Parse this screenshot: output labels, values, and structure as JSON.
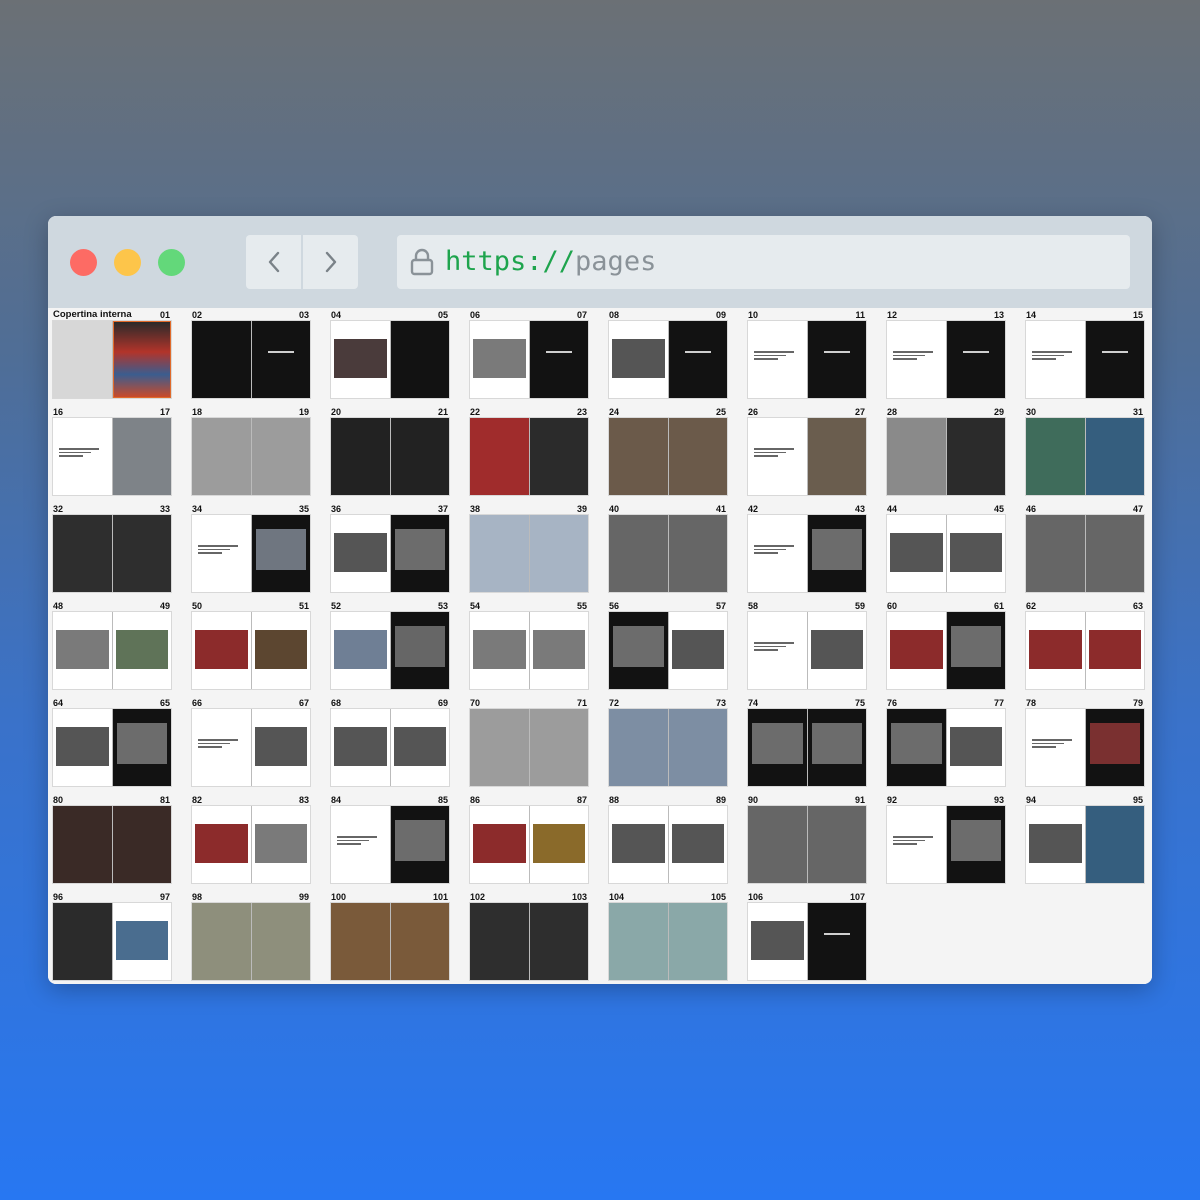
{
  "browser": {
    "url_scheme": "https://",
    "url_path": "pages",
    "back_icon": "chevron-left-icon",
    "forward_icon": "chevron-right-icon",
    "lock_icon": "lock-icon",
    "colors": {
      "close": "#fd6b64",
      "minimize": "#fdc54a",
      "maximize": "#63d87a",
      "scheme": "#1ea44d"
    }
  },
  "spreads": [
    {
      "left": "Copertina interna",
      "right": "01",
      "pages": [
        "gray",
        "cover"
      ]
    },
    {
      "left": "02",
      "right": "03",
      "pages": [
        "black",
        "black-title"
      ]
    },
    {
      "left": "04",
      "right": "05",
      "pages": [
        "white-photo-rose",
        "black"
      ]
    },
    {
      "left": "06",
      "right": "07",
      "pages": [
        "white-photo-gray",
        "black-text"
      ]
    },
    {
      "left": "08",
      "right": "09",
      "pages": [
        "white-photo-bw",
        "black-title"
      ]
    },
    {
      "left": "10",
      "right": "11",
      "pages": [
        "white-text",
        "black-title"
      ]
    },
    {
      "left": "12",
      "right": "13",
      "pages": [
        "white-text",
        "black-title"
      ]
    },
    {
      "left": "14",
      "right": "15",
      "pages": [
        "white-text",
        "black-title"
      ]
    },
    {
      "left": "16",
      "right": "17",
      "pages": [
        "white-text",
        "photo-fog"
      ]
    },
    {
      "left": "18",
      "right": "19",
      "pages": [
        "full-gray",
        "full-gray"
      ]
    },
    {
      "left": "20",
      "right": "21",
      "pages": [
        "black-sky",
        "black-sky"
      ]
    },
    {
      "left": "22",
      "right": "23",
      "pages": [
        "photo-red",
        "photo-dark"
      ]
    },
    {
      "left": "24",
      "right": "25",
      "pages": [
        "full-brown",
        "full-brown"
      ]
    },
    {
      "left": "26",
      "right": "27",
      "pages": [
        "white-text",
        "photo-street"
      ]
    },
    {
      "left": "28",
      "right": "29",
      "pages": [
        "photo-gray",
        "photo-dark"
      ]
    },
    {
      "left": "30",
      "right": "31",
      "pages": [
        "photo-green",
        "photo-blue"
      ]
    },
    {
      "left": "32",
      "right": "33",
      "pages": [
        "full-dark",
        "full-dark"
      ]
    },
    {
      "left": "34",
      "right": "35",
      "pages": [
        "white-text",
        "black-fog"
      ]
    },
    {
      "left": "36",
      "right": "37",
      "pages": [
        "white-photo-bw",
        "black-photo"
      ]
    },
    {
      "left": "38",
      "right": "39",
      "pages": [
        "full-umbrella",
        "full-umbrella"
      ]
    },
    {
      "left": "40",
      "right": "41",
      "pages": [
        "full-bw",
        "full-bw"
      ]
    },
    {
      "left": "42",
      "right": "43",
      "pages": [
        "white-text",
        "black-photo"
      ]
    },
    {
      "left": "44",
      "right": "45",
      "pages": [
        "white-photo-bw",
        "white-photo-bw"
      ]
    },
    {
      "left": "46",
      "right": "47",
      "pages": [
        "full-bw",
        "full-bw"
      ]
    },
    {
      "left": "48",
      "right": "49",
      "pages": [
        "white-photo-gray",
        "white-photo-green"
      ]
    },
    {
      "left": "50",
      "right": "51",
      "pages": [
        "white-photo-red",
        "white-photo-brown"
      ]
    },
    {
      "left": "52",
      "right": "53",
      "pages": [
        "white-photo-blur",
        "black-sign"
      ]
    },
    {
      "left": "54",
      "right": "55",
      "pages": [
        "white-photo-gray",
        "white-photo-gray"
      ]
    },
    {
      "left": "56",
      "right": "57",
      "pages": [
        "black-photo",
        "white-photo-bw"
      ]
    },
    {
      "left": "58",
      "right": "59",
      "pages": [
        "white-text",
        "white-photo-bw"
      ]
    },
    {
      "left": "60",
      "right": "61",
      "pages": [
        "white-photo-red",
        "black-photo"
      ]
    },
    {
      "left": "62",
      "right": "63",
      "pages": [
        "white-photo-red",
        "white-photo-red"
      ]
    },
    {
      "left": "64",
      "right": "65",
      "pages": [
        "white-photo-bw",
        "black-photo"
      ]
    },
    {
      "left": "66",
      "right": "67",
      "pages": [
        "white-text",
        "white-photo-bw"
      ]
    },
    {
      "left": "68",
      "right": "69",
      "pages": [
        "white-photo-bw",
        "white-photo-bw"
      ]
    },
    {
      "left": "70",
      "right": "71",
      "pages": [
        "full-gray",
        "full-gray"
      ]
    },
    {
      "left": "72",
      "right": "73",
      "pages": [
        "full-street",
        "full-street"
      ]
    },
    {
      "left": "74",
      "right": "75",
      "pages": [
        "black-photo",
        "black-photo"
      ]
    },
    {
      "left": "76",
      "right": "77",
      "pages": [
        "black-photo",
        "white-photo-bw"
      ]
    },
    {
      "left": "78",
      "right": "79",
      "pages": [
        "white-text",
        "black-photo-red"
      ]
    },
    {
      "left": "80",
      "right": "81",
      "pages": [
        "full-dark-red",
        "full-dark-red"
      ]
    },
    {
      "left": "82",
      "right": "83",
      "pages": [
        "white-photo-red",
        "white-photo-gray"
      ]
    },
    {
      "left": "84",
      "right": "85",
      "pages": [
        "white-text",
        "black-photo"
      ]
    },
    {
      "left": "86",
      "right": "87",
      "pages": [
        "white-photo-red",
        "white-photo-yellow"
      ]
    },
    {
      "left": "88",
      "right": "89",
      "pages": [
        "white-photo-bw",
        "white-photo-bw"
      ]
    },
    {
      "left": "90",
      "right": "91",
      "pages": [
        "full-bw",
        "full-bw"
      ]
    },
    {
      "left": "92",
      "right": "93",
      "pages": [
        "white-text",
        "black-photo"
      ]
    },
    {
      "left": "94",
      "right": "95",
      "pages": [
        "white-photo-bw",
        "photo-blue"
      ]
    },
    {
      "left": "96",
      "right": "97",
      "pages": [
        "photo-dark",
        "white-photo-blue"
      ]
    },
    {
      "left": "98",
      "right": "99",
      "pages": [
        "full-warm",
        "full-warm"
      ]
    },
    {
      "left": "100",
      "right": "101",
      "pages": [
        "full-orange",
        "full-orange"
      ]
    },
    {
      "left": "102",
      "right": "103",
      "pages": [
        "full-dark",
        "full-dark"
      ]
    },
    {
      "left": "104",
      "right": "105",
      "pages": [
        "full-teal",
        "full-teal"
      ]
    },
    {
      "left": "106",
      "right": "107",
      "pages": [
        "white-photo-bw",
        "black-text"
      ]
    }
  ]
}
